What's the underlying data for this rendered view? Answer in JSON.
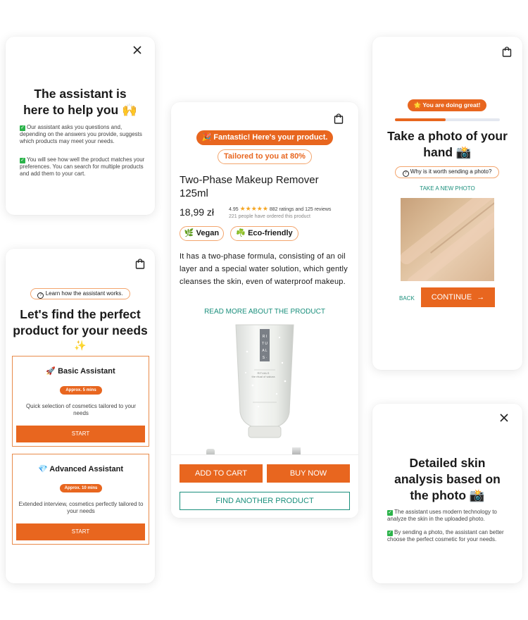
{
  "colors": {
    "accent": "#e8661f",
    "teal": "#1a8f7c",
    "check_green": "#2bb34a",
    "star": "#f5a623"
  },
  "card1": {
    "close_icon": "close-icon",
    "title_line1": "The assistant is",
    "title_line2": "here to help you 🙌",
    "point1": "Our assistant asks you questions and, depending on the answers you provide, suggests which products may meet your needs.",
    "point2": "You will see how well the product matches your preferences. You can search for multiple products and add them to your cart."
  },
  "card2": {
    "learn_label": "Learn how the assistant works.",
    "title_line1": "Let's find the perfect",
    "title_line2": "product for your needs",
    "title_emoji": "✨",
    "basic": {
      "title": "🚀 Basic Assistant",
      "time": "Approx. 5 mins",
      "desc": "Quick selection of cosmetics tailored to your needs",
      "start": "START"
    },
    "advanced": {
      "title": "💎 Advanced Assistant",
      "time": "Approx. 10 mins",
      "desc": "Extended interview, cosmetics perfectly tailored to your needs",
      "start": "START"
    }
  },
  "card3": {
    "banner": "🎉 Fantastic! Here's your product.",
    "tailored": "Tailored to you at 80%",
    "product_line1": "Two-Phase Makeup Remover",
    "product_line2": "125ml",
    "price": "18,99 zł",
    "rating": "4.95",
    "rating_count": "882 ratings and 125 reviews",
    "ordered": "221 people have ordered this product",
    "tags": [
      "🌿 Vegan",
      "☘️ Eco-friendly"
    ],
    "description": "It has a two-phase formula, consisting of an oil layer and a special water solution, which gently cleanses the skin, even of waterproof makeup.",
    "read_more": "READ MORE ABOUT THE PRODUCT",
    "tube_brand": "RITUALS",
    "tube_text": "the ritual of sakura",
    "add_to_cart": "ADD TO CART",
    "buy_now": "BUY NOW",
    "find_another": "FIND ANOTHER PRODUCT"
  },
  "card4": {
    "progress_pill": "🌟 You are doing great!",
    "progress": 0.48,
    "title_line1": "Take a photo of your",
    "title_line2": "hand 📸",
    "why_label": "Why is it worth sending a photo?",
    "take_new": "TAKE A NEW PHOTO",
    "back": "BACK",
    "continue": "CONTINUE"
  },
  "card5": {
    "title_line1": "Detailed skin",
    "title_line2": "analysis based on",
    "title_line3": "the photo 📸",
    "point1": "The assistant uses modern technology to analyze the skin in the uploaded photo.",
    "point2": "By sending a photo, the assistant can better choose the perfect cosmetic for your needs."
  }
}
